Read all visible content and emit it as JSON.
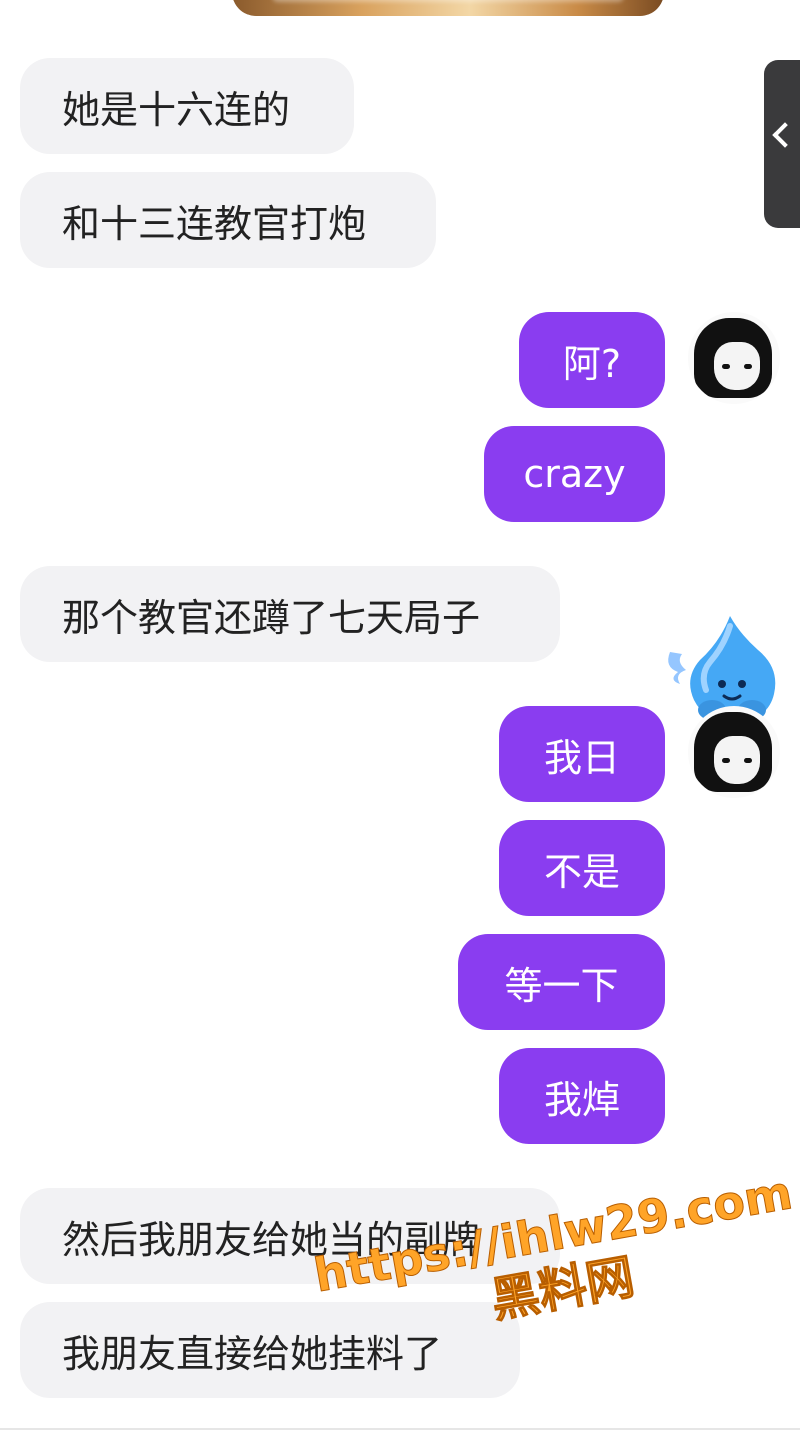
{
  "messages": [
    {
      "side": "in",
      "text": "她是十六连的"
    },
    {
      "side": "in",
      "text": "和十三连教官打炮"
    },
    {
      "side": "out",
      "text": "阿?"
    },
    {
      "side": "out",
      "text": "crazy"
    },
    {
      "side": "in",
      "text": "那个教官还蹲了七天局子"
    },
    {
      "side": "out",
      "text": "我日"
    },
    {
      "side": "out",
      "text": "不是"
    },
    {
      "side": "out",
      "text": "等一下"
    },
    {
      "side": "out",
      "text": "我焯"
    },
    {
      "side": "in",
      "text": "然后我朋友给她当的副牌"
    },
    {
      "side": "in",
      "text": "我朋友直接给她挂料了"
    }
  ],
  "watermark": {
    "url": "https://ihlw29.com",
    "label": "黑料网"
  },
  "colors": {
    "incoming_bubble": "#f2f2f4",
    "outgoing_bubble": "#8a3df0",
    "watermark": "#ffa428"
  },
  "icons": [
    "chevron-left-icon",
    "user-avatar",
    "mascot-sticker-icon"
  ]
}
